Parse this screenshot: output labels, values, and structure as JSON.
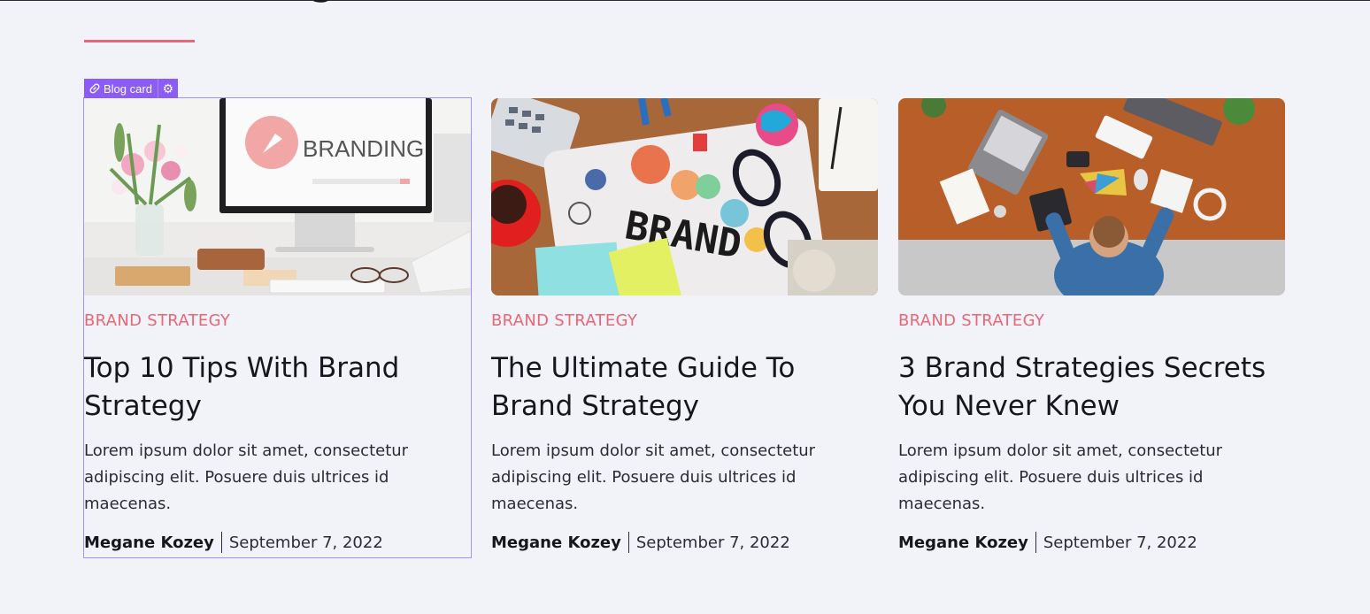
{
  "section": {
    "heading_fragment": "g",
    "accent_color": "#e96676"
  },
  "editor": {
    "badge_label": "Blog card",
    "link_icon": "link-icon",
    "settings_icon": "gear-icon",
    "selection_color": "#a493f3"
  },
  "cards": [
    {
      "image_text": "BRANDING",
      "category": "Brand Strategy",
      "title": "Top 10 Tips With Brand Strategy",
      "excerpt": "Lorem ipsum dolor sit amet, consectetur adipiscing elit. Posuere duis ultrices id maecenas.",
      "author": "Megane Kozey",
      "date": "September 7, 2022"
    },
    {
      "image_text": "BRAND",
      "category": "Brand Strategy",
      "title": "The Ultimate Guide To Brand Strategy",
      "excerpt": "Lorem ipsum dolor sit amet, consectetur adipiscing elit. Posuere duis ultrices id maecenas.",
      "author": "Megane Kozey",
      "date": "September 7, 2022"
    },
    {
      "category": "Brand Strategy",
      "title": "3 Brand Strategies Secrets You Never Knew",
      "excerpt": "Lorem ipsum dolor sit amet, consectetur adipiscing elit. Posuere duis ultrices id maecenas.",
      "author": "Megane Kozey",
      "date": "September 7, 2022"
    }
  ]
}
